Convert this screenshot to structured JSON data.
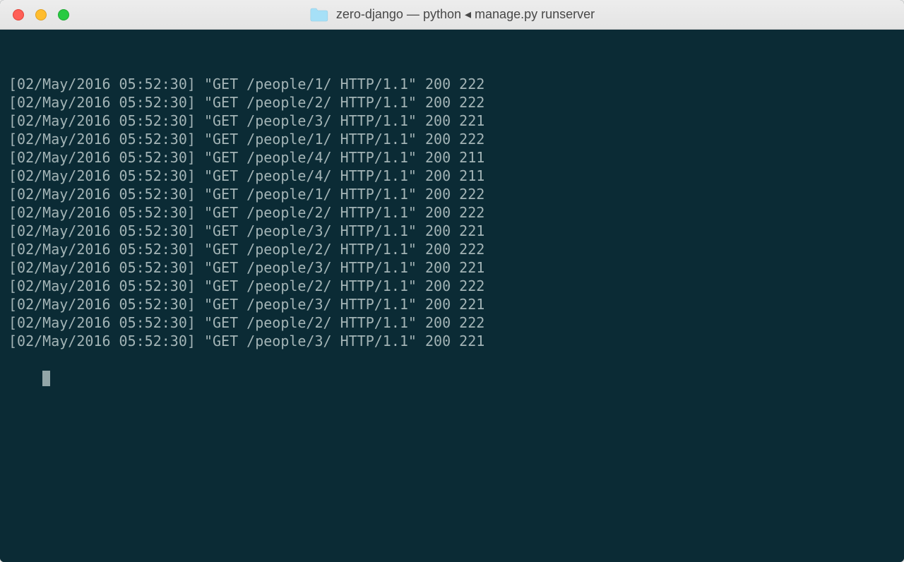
{
  "window": {
    "title_folder": "zero-django",
    "title_proc": "python",
    "title_args": "manage.py runserver"
  },
  "colors": {
    "terminal_bg": "#0b2b35",
    "terminal_fg": "#a3b4b6",
    "titlebar_bg": "#e7e7e7"
  },
  "log_lines": [
    "[02/May/2016 05:52:30] \"GET /people/1/ HTTP/1.1\" 200 222",
    "[02/May/2016 05:52:30] \"GET /people/2/ HTTP/1.1\" 200 222",
    "[02/May/2016 05:52:30] \"GET /people/3/ HTTP/1.1\" 200 221",
    "[02/May/2016 05:52:30] \"GET /people/1/ HTTP/1.1\" 200 222",
    "[02/May/2016 05:52:30] \"GET /people/4/ HTTP/1.1\" 200 211",
    "[02/May/2016 05:52:30] \"GET /people/4/ HTTP/1.1\" 200 211",
    "[02/May/2016 05:52:30] \"GET /people/1/ HTTP/1.1\" 200 222",
    "[02/May/2016 05:52:30] \"GET /people/2/ HTTP/1.1\" 200 222",
    "[02/May/2016 05:52:30] \"GET /people/3/ HTTP/1.1\" 200 221",
    "[02/May/2016 05:52:30] \"GET /people/2/ HTTP/1.1\" 200 222",
    "[02/May/2016 05:52:30] \"GET /people/3/ HTTP/1.1\" 200 221",
    "[02/May/2016 05:52:30] \"GET /people/2/ HTTP/1.1\" 200 222",
    "[02/May/2016 05:52:30] \"GET /people/3/ HTTP/1.1\" 200 221",
    "[02/May/2016 05:52:30] \"GET /people/2/ HTTP/1.1\" 200 222",
    "[02/May/2016 05:52:30] \"GET /people/3/ HTTP/1.1\" 200 221"
  ]
}
